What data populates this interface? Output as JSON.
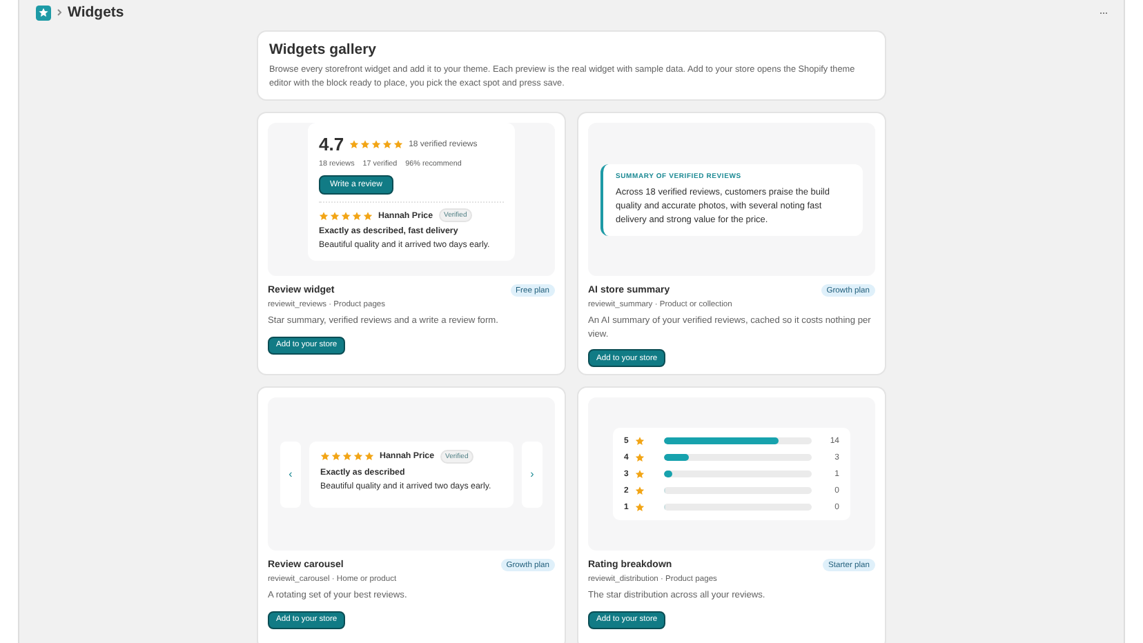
{
  "header": {
    "title": "Widgets",
    "menu": "···"
  },
  "intro": {
    "title": "Widgets gallery",
    "text": "Browse every storefront widget and add it to your theme. Each preview is the real widget with sample data. Add to your store opens the Shopify theme editor with the block ready to place, you pick the exact spot and press save."
  },
  "widgets": [
    {
      "kind": "review",
      "name": "Review widget",
      "plan": "Free plan",
      "handle": "reviewit_reviews · Product pages",
      "description": "Star summary, verified reviews and a write a review form.",
      "button": "Add to your store",
      "preview": {
        "rating": "4.7",
        "stars": 5,
        "count": "18 verified reviews",
        "stats": [
          "18 reviews",
          "17 verified",
          "96% recommend"
        ],
        "write_button": "Write a review",
        "review": {
          "stars": 5,
          "author": "Hannah Price",
          "badge": "Verified",
          "title": "Exactly as described, fast delivery",
          "body": "Beautiful quality and it arrived two days early."
        }
      }
    },
    {
      "kind": "summary",
      "name": "AI store summary",
      "plan": "Growth plan",
      "handle": "reviewit_summary · Product or collection",
      "description": "An AI summary of your verified reviews, cached so it costs nothing per view.",
      "button": "Add to your store",
      "preview": {
        "heading": "SUMMARY OF VERIFIED REVIEWS",
        "text": "Across 18 verified reviews, customers praise the build quality and accurate photos, with several noting fast delivery and strong value for the price."
      }
    },
    {
      "kind": "carousel",
      "name": "Review carousel",
      "plan": "Growth plan",
      "handle": "reviewit_carousel · Home or product",
      "description": "A rotating set of your best reviews.",
      "button": "Add to your store",
      "preview": {
        "prev": "‹",
        "next": "›",
        "review": {
          "stars": 5,
          "author": "Hannah Price",
          "badge": "Verified",
          "title": "Exactly as described",
          "body": "Beautiful quality and it arrived two days early."
        }
      }
    },
    {
      "kind": "breakdown",
      "name": "Rating breakdown",
      "plan": "Starter plan",
      "handle": "reviewit_distribution · Product pages",
      "description": "The star distribution across all your reviews.",
      "button": "Add to your store",
      "preview": {
        "rows": [
          {
            "label": "5",
            "level": 0.78,
            "count": "14"
          },
          {
            "label": "4",
            "level": 0.17,
            "count": "3"
          },
          {
            "label": "3",
            "level": 0.06,
            "count": "1"
          },
          {
            "label": "2",
            "level": 0,
            "count": "0"
          },
          {
            "label": "1",
            "level": 0,
            "count": "0"
          }
        ]
      }
    }
  ]
}
